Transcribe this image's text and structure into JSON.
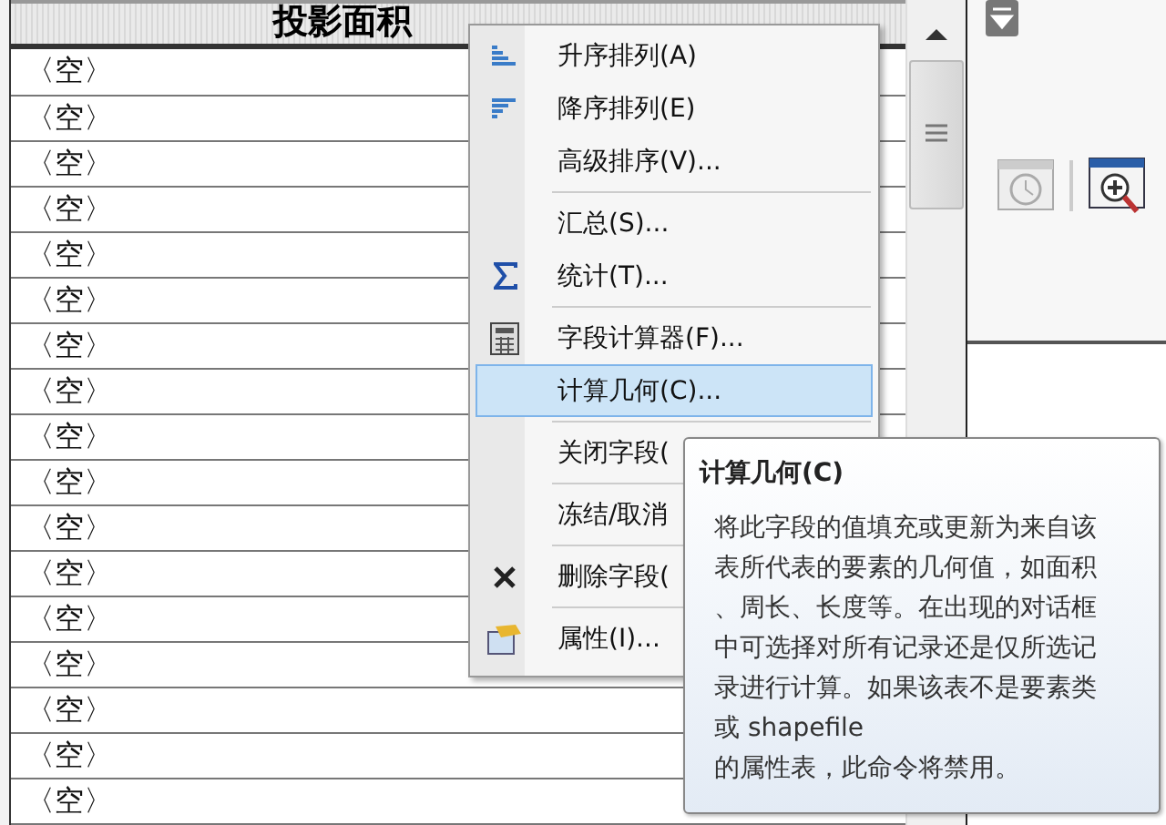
{
  "table": {
    "column": {
      "label": "投影面积"
    },
    "rows": [
      "〈空〉",
      "〈空〉",
      "〈空〉",
      "〈空〉",
      "〈空〉",
      "〈空〉",
      "〈空〉",
      "〈空〉",
      "〈空〉",
      "〈空〉",
      "〈空〉",
      "〈空〉",
      "〈空〉",
      "〈空〉",
      "〈空〉",
      "〈空〉",
      "〈空〉"
    ]
  },
  "context_menu": {
    "items": [
      {
        "kind": "sort-ascending",
        "label": "升序排列(A)",
        "selected": false
      },
      {
        "kind": "sort-descending",
        "label": "降序排列(E)",
        "selected": false
      },
      {
        "kind": "plain",
        "label": "高级排序(V)...",
        "selected": false
      },
      {
        "kind": "separator"
      },
      {
        "kind": "plain",
        "label": "汇总(S)...",
        "selected": false
      },
      {
        "kind": "statistics",
        "label": "统计(T)...",
        "selected": false
      },
      {
        "kind": "separator"
      },
      {
        "kind": "calculator",
        "label": "字段计算器(F)...",
        "selected": false
      },
      {
        "kind": "plain",
        "label": "计算几何(C)...",
        "selected": true
      },
      {
        "kind": "separator"
      },
      {
        "kind": "plain",
        "label": "关闭字段(",
        "selected": false
      },
      {
        "kind": "separator"
      },
      {
        "kind": "plain",
        "label": "冻结/取消",
        "selected": false
      },
      {
        "kind": "separator"
      },
      {
        "kind": "delete",
        "label": "删除字段(",
        "selected": false
      },
      {
        "kind": "separator"
      },
      {
        "kind": "properties",
        "label": "属性(I)...",
        "selected": false
      }
    ]
  },
  "tooltip": {
    "title": "计算几何(C)",
    "text": "将此字段的值填充或更新为来自该表所代表的要素的几何值，如面积、周长、长度等。在出现的对话框中可选择对所有记录还是仅所选记录进行计算。如果该表不是要素类或 shapefile\n的属性表，此命令将禁用。"
  }
}
